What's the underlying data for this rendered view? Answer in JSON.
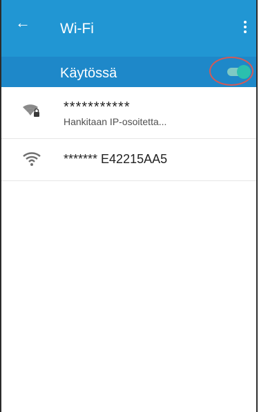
{
  "header": {
    "title": "Wi-Fi",
    "back_icon": "arrow-left-icon",
    "more_icon": "more-vert-icon"
  },
  "wifi_switch": {
    "label": "Käytössä",
    "state": "on",
    "accent": "#2bbfae"
  },
  "networks": [
    {
      "ssid": "***********",
      "status": "Hankitaan IP-osoitetta...",
      "icon": "wifi-lock-icon"
    },
    {
      "ssid": "******* E42215AA5",
      "status": "",
      "icon": "wifi-icon"
    }
  ],
  "colors": {
    "appbar": "#2196d3",
    "switchbar": "#1e88c9",
    "highlight_circle": "#d35a57"
  }
}
